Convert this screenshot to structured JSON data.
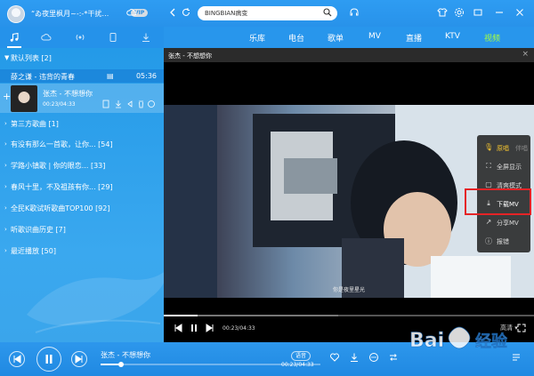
{
  "titlebar": {
    "username": "“ゐ夜里枫月~-:-*干扰…",
    "vip": "VIP",
    "search_value": "BINGBIAN病变"
  },
  "nav": {
    "items": [
      "乐库",
      "电台",
      "歌单",
      "MV",
      "直播",
      "KTV",
      "视频"
    ],
    "active_index": 6
  },
  "sidebar": {
    "tabs": [
      "music-note-icon",
      "cloud-icon",
      "radio-icon",
      "device-icon",
      "download-icon"
    ],
    "lists": [
      {
        "label": "默认列表 [2]"
      },
      {
        "label": "第三方歌曲 [1]"
      },
      {
        "label": "有没有那么一首歌，让你... [54]"
      },
      {
        "label": "学路小镇歌 | 你的眼恋... [33]"
      },
      {
        "label": "春风十里，不及祖孩有你... [29]"
      },
      {
        "label": "全民K歌试听歌曲TOP100 [92]"
      },
      {
        "label": "听歌识曲历史 [7]"
      },
      {
        "label": "最近播放 [50]"
      }
    ],
    "song_row": {
      "title": "薛之谦 - 违背的青春",
      "time": "05:36"
    },
    "now_playing": {
      "name": "张杰 - 不想想你",
      "time": "00:23/04:33"
    }
  },
  "video": {
    "title": "张杰 - 不想想你",
    "subtitle": "你是夜里星光",
    "time": "00:23/04:33",
    "quality": "高清",
    "progress": 0.092,
    "buffered": 0.47
  },
  "menu": {
    "items": [
      {
        "label": "原唱",
        "extra": "伴唱",
        "icon": "mic-icon"
      },
      {
        "label": "全屏显示",
        "icon": "fullscreen-icon"
      },
      {
        "label": "清爽模式",
        "icon": "clean-mode-icon"
      },
      {
        "label": "下载MV",
        "icon": "download-icon"
      },
      {
        "label": "分享MV",
        "icon": "share-icon"
      },
      {
        "label": "报错",
        "icon": "report-icon"
      }
    ]
  },
  "player": {
    "title": "张杰 - 不想想你",
    "time": "00:23/04:33",
    "badge": "语音",
    "progress": 0.093
  },
  "watermark": {
    "text": "Bai经验"
  },
  "colors": {
    "accent": "#2892ea",
    "highlight": "#e52326",
    "active_nav": "#a8ff3c"
  }
}
